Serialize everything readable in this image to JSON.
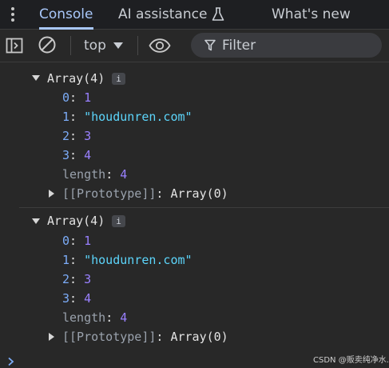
{
  "tabs": [
    {
      "label": "Console",
      "active": true
    },
    {
      "label": "AI assistance",
      "icon": "flask-icon"
    },
    {
      "label": "What's new"
    }
  ],
  "toolbar": {
    "context": "top",
    "filter_placeholder": "Filter"
  },
  "console": {
    "entries": [
      {
        "summary": "Array(4)",
        "info_badge": "i",
        "items": [
          {
            "key": "0",
            "value": "1"
          },
          {
            "key": "1",
            "value": "\"houdunren.com\""
          },
          {
            "key": "2",
            "value": "3"
          },
          {
            "key": "3",
            "value": "4"
          },
          {
            "key": "length",
            "value": "4"
          }
        ],
        "prototype_key": "[[Prototype]]",
        "prototype_value": "Array(0)"
      },
      {
        "summary": "Array(4)",
        "info_badge": "i",
        "items": [
          {
            "key": "0",
            "value": "1"
          },
          {
            "key": "1",
            "value": "\"houdunren.com\""
          },
          {
            "key": "2",
            "value": "3"
          },
          {
            "key": "3",
            "value": "4"
          },
          {
            "key": "length",
            "value": "4"
          }
        ],
        "prototype_key": "[[Prototype]]",
        "prototype_value": "Array(0)"
      }
    ]
  },
  "watermark": "CSDN @贩卖纯净水.",
  "colors": {
    "background": "#282828",
    "accent": "#a8c7fa",
    "key": "#7cacf8",
    "number": "#9980ff",
    "string": "#5cd5fb"
  }
}
